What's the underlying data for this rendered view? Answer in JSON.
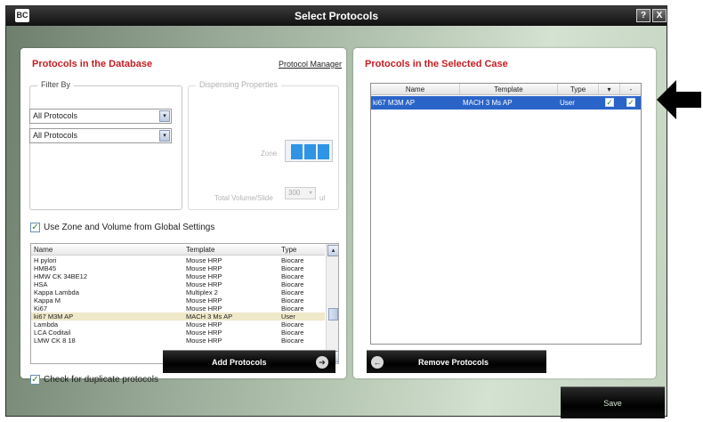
{
  "window": {
    "title": "Select Protocols",
    "logo_text": "BC",
    "help_label": "?",
    "close_label": "X"
  },
  "left_panel": {
    "heading": "Protocols in the Database",
    "manager_link": "Protocol Manager",
    "filter": {
      "group_title": "Filter By",
      "select1_value": "All Protocols",
      "select2_value": "All Protocols"
    },
    "dispensing": {
      "group_title": "Dispensing Properties",
      "zone_label": "Zone",
      "volume_label": "Total Volume/Slide",
      "volume_value": "300",
      "volume_unit": "ul"
    },
    "use_global_label": "Use Zone and Volume from Global Settings",
    "use_global_checked": true,
    "list": {
      "columns": [
        "Name",
        "Template",
        "Type"
      ],
      "rows": [
        {
          "name": "Name",
          "template": "Template",
          "type": "Type",
          "_header": true
        },
        {
          "name": "H pylori",
          "template": "Mouse HRP",
          "type": "Biocare"
        },
        {
          "name": "HMB45",
          "template": "Mouse HRP",
          "type": "Biocare"
        },
        {
          "name": "HMW CK 34BE12",
          "template": "Mouse HRP",
          "type": "Biocare"
        },
        {
          "name": "HSA",
          "template": "Mouse HRP",
          "type": "Biocare"
        },
        {
          "name": "Kappa Lambda",
          "template": "Multiplex 2",
          "type": "Biocare"
        },
        {
          "name": "Kappa M",
          "template": "Mouse HRP",
          "type": "Biocare"
        },
        {
          "name": "Ki67",
          "template": "Mouse HRP",
          "type": "Biocare"
        },
        {
          "name": "ki67 M3M AP",
          "template": "MACH 3 Ms AP",
          "type": "User"
        },
        {
          "name": "Lambda",
          "template": "Mouse HRP",
          "type": "Biocare"
        },
        {
          "name": "LCA Coditail",
          "template": "Mouse HRP",
          "type": "Biocare"
        },
        {
          "name": "LMW CK 8 18",
          "template": "Mouse HRP",
          "type": "Biocare"
        }
      ],
      "selected_index": 8
    },
    "duplicate_label": "Check for duplicate protocols",
    "duplicate_checked": true,
    "add_button": "Add Protocols"
  },
  "right_panel": {
    "heading": "Protocols in the Selected Case",
    "columns": [
      "Name",
      "Template",
      "Type",
      "▾",
      "-"
    ],
    "rows": [
      {
        "name": "ki67 M3M AP",
        "template": "MACH 3 Ms AP",
        "type": "User",
        "check_a": true,
        "check_b": true
      }
    ],
    "remove_button": "Remove Protocols"
  },
  "save_button": "Save",
  "colors": {
    "heading_red": "#c41e24",
    "selection_blue": "#2a64c8",
    "zone_blue": "#2f94e3"
  },
  "icons": {
    "dropdown": "▾",
    "scroll_up": "▴",
    "scroll_down": "▾",
    "check": "✓",
    "arrow_right": "➔",
    "arrow_left": "←"
  }
}
